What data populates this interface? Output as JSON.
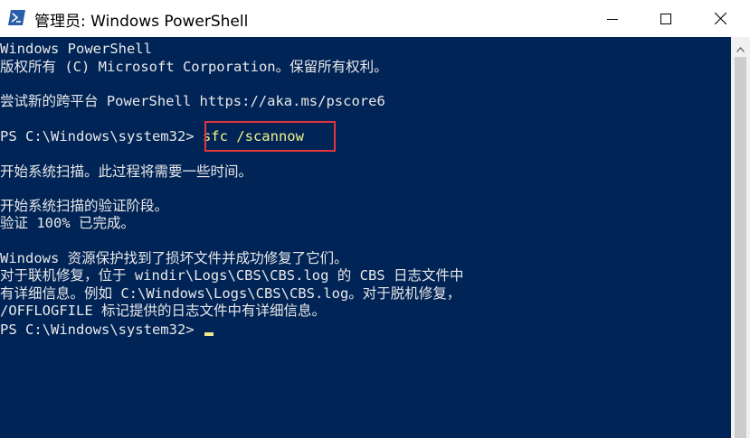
{
  "window": {
    "title": "管理员: Windows PowerShell",
    "app_icon": "powershell-icon",
    "controls": [
      "minimize-icon",
      "maximize-icon",
      "close-icon"
    ]
  },
  "console": {
    "lines": [
      "Windows PowerShell",
      "版权所有 (C) Microsoft Corporation。保留所有权利。",
      "",
      "尝试新的跨平台 PowerShell https://aka.ms/pscore6",
      "",
      "",
      "开始系统扫描。此过程将需要一些时间。",
      "",
      "开始系统扫描的验证阶段。",
      "验证 100% 已完成。",
      "",
      "Windows 资源保护找到了损坏文件并成功修复了它们。",
      "对于联机修复，位于 windir\\Logs\\CBS\\CBS.log 的 CBS 日志文件中",
      "有详细信息。例如 C:\\Windows\\Logs\\CBS\\CBS.log。对于脱机修复，",
      "/OFFLOGFILE 标记提供的日志文件中有详细信息。"
    ],
    "prompt": "PS C:\\Windows\\system32> ",
    "command": "sfc /scannow",
    "final_prompt": "PS C:\\Windows\\system32> "
  },
  "colors": {
    "console_bg": "#012456",
    "console_text": "#e8e8e8",
    "command_text": "#f2f28a",
    "highlight_border": "#e4343c"
  }
}
